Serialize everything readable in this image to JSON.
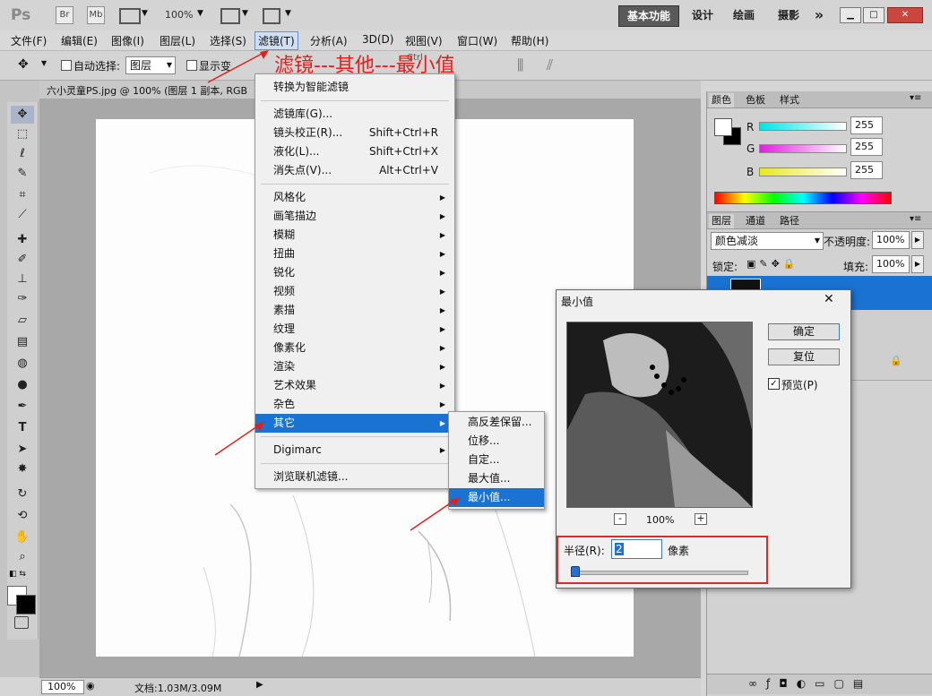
{
  "titlebar": {
    "logo": "Ps",
    "br": "Br",
    "mb": "Mb",
    "zoom": "100%",
    "workspaces": [
      "基本功能",
      "设计",
      "绘画",
      "摄影"
    ],
    "more": "»"
  },
  "menubar": {
    "items": [
      "文件(F)",
      "编辑(E)",
      "图像(I)",
      "图层(L)",
      "选择(S)",
      "滤镜(T)",
      "分析(A)",
      "3D(D)",
      "视图(V)",
      "窗口(W)",
      "帮助(H)"
    ]
  },
  "options": {
    "auto_select": "自动选择:",
    "auto_select_value": "图层",
    "show_transform": "显示变"
  },
  "annotation": {
    "text": "滤镜---其他---最小值",
    "color": "#e0201c"
  },
  "document": {
    "tab_title": "六小灵童PS.jpg @ 100% (图层 1 副本, RGB",
    "zoom": "100%",
    "doc_info": "文档:1.03M/3.09M"
  },
  "filter_menu": {
    "convert": "转换为智能滤镜",
    "group1": [
      {
        "label": "滤镜库(G)...",
        "shortcut": ""
      },
      {
        "label": "镜头校正(R)...",
        "shortcut": "Shift+Ctrl+R"
      },
      {
        "label": "液化(L)...",
        "shortcut": "Shift+Ctrl+X"
      },
      {
        "label": "消失点(V)...",
        "shortcut": "Alt+Ctrl+V"
      }
    ],
    "group2": [
      "风格化",
      "画笔描边",
      "模糊",
      "扭曲",
      "锐化",
      "视频",
      "素描",
      "纹理",
      "像素化",
      "渲染",
      "艺术效果",
      "杂色",
      "其它"
    ],
    "digimarc": "Digimarc",
    "browse": "浏览联机滤镜...",
    "hidden_shortcut": "Ctrl"
  },
  "submenu": {
    "items": [
      "高反差保留...",
      "位移...",
      "自定...",
      "最大值...",
      "最小值..."
    ]
  },
  "dialog": {
    "title": "最小值",
    "close": "✕",
    "ok": "确定",
    "reset": "复位",
    "preview_label": "预览(P)",
    "zoom_out": "-",
    "zoom_in": "+",
    "zoom": "100%",
    "radius_label": "半径(R):",
    "radius_value": "2",
    "unit": "像素",
    "slider_level": 0.02
  },
  "color_panel": {
    "tabs": [
      "颜色",
      "色板",
      "样式"
    ],
    "channels": [
      {
        "name": "R",
        "value": "255",
        "color": "#00e5e5"
      },
      {
        "name": "G",
        "value": "255",
        "color": "#e020e0"
      },
      {
        "name": "B",
        "value": "255",
        "color": "#e8e820"
      }
    ]
  },
  "layers_panel": {
    "tabs": [
      "图层",
      "通道",
      "路径"
    ],
    "blend_mode": "颜色减淡",
    "opacity_label": "不透明度:",
    "opacity_value": "100%",
    "lock_label": "锁定:",
    "fill_label": "填充:",
    "fill_value": "100%"
  }
}
